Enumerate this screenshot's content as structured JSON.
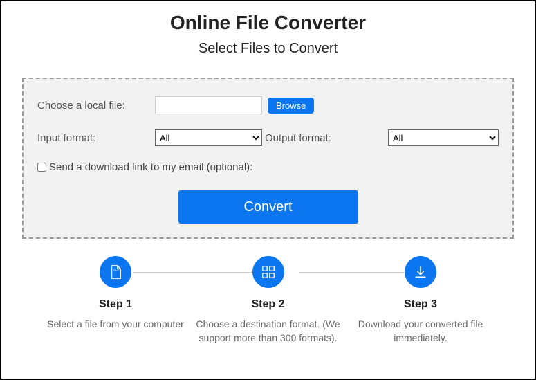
{
  "title": "Online File Converter",
  "subtitle": "Select Files to Convert",
  "panel": {
    "local_file_label": "Choose a local file:",
    "browse_label": "Browse",
    "file_value": "",
    "input_format_label": "Input format:",
    "input_format_value": "All",
    "output_format_label": "Output format:",
    "output_format_value": "All",
    "email_checkbox_label": "Send a download link to my email (optional):",
    "convert_label": "Convert"
  },
  "steps": [
    {
      "title": "Step 1",
      "desc": "Select a file from your computer"
    },
    {
      "title": "Step 2",
      "desc": "Choose a destination format. (We support more than 300 formats)."
    },
    {
      "title": "Step 3",
      "desc": "Download your converted file immediately."
    }
  ]
}
